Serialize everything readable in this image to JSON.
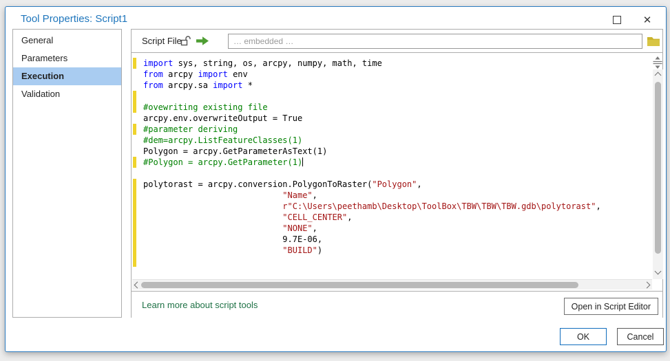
{
  "window": {
    "title": "Tool Properties: Script1",
    "close_icon": "✕"
  },
  "sidebar": {
    "items": [
      {
        "label": "General",
        "selected": false
      },
      {
        "label": "Parameters",
        "selected": false
      },
      {
        "label": "Execution",
        "selected": true
      },
      {
        "label": "Validation",
        "selected": false
      }
    ]
  },
  "script_file": {
    "label": "Script File",
    "placeholder": "… embedded …"
  },
  "editor": {
    "lines": [
      {
        "changed": true,
        "segments": [
          [
            "import",
            "kw"
          ],
          [
            " sys, string, os, arcpy, numpy, math, time",
            "pl"
          ]
        ]
      },
      {
        "changed": false,
        "segments": [
          [
            "from",
            "kw"
          ],
          [
            " arcpy ",
            "pl"
          ],
          [
            "import",
            "kw"
          ],
          [
            " env",
            "pl"
          ]
        ]
      },
      {
        "changed": false,
        "segments": [
          [
            "from",
            "kw"
          ],
          [
            " arcpy.sa ",
            "pl"
          ],
          [
            "import",
            "kw"
          ],
          [
            " *",
            "pl"
          ]
        ]
      },
      {
        "changed": true,
        "segments": []
      },
      {
        "changed": true,
        "segments": [
          [
            "#ovewriting existing file",
            "cm"
          ]
        ]
      },
      {
        "changed": false,
        "segments": [
          [
            "arcpy.env.overwriteOutput = True",
            "pl"
          ]
        ]
      },
      {
        "changed": true,
        "segments": [
          [
            "#parameter deriving",
            "cm"
          ]
        ]
      },
      {
        "changed": false,
        "segments": [
          [
            "#dem=arcpy.ListFeatureClasses(1)",
            "cm"
          ]
        ]
      },
      {
        "changed": false,
        "segments": [
          [
            "Polygon = arcpy.GetParameterAsText(1)",
            "pl"
          ]
        ]
      },
      {
        "changed": true,
        "cursor": true,
        "segments": [
          [
            "#Polygon = arcpy.GetParameter(1)",
            "cm"
          ]
        ]
      },
      {
        "changed": false,
        "segments": []
      },
      {
        "changed": true,
        "segments": [
          [
            "polytorast = arcpy.conversion.PolygonToRaster(",
            "pl"
          ],
          [
            "\"Polygon\"",
            "st"
          ],
          [
            ",",
            "pl"
          ]
        ]
      },
      {
        "changed": true,
        "segments": [
          [
            "                            ",
            "pl"
          ],
          [
            "\"Name\"",
            "st"
          ],
          [
            ",",
            "pl"
          ]
        ]
      },
      {
        "changed": true,
        "segments": [
          [
            "                            ",
            "pl"
          ],
          [
            "r\"C:\\Users\\peethamb\\Desktop\\ToolBox\\TBW\\TBW\\TBW.gdb\\polytorast\"",
            "st"
          ],
          [
            ",",
            "pl"
          ]
        ]
      },
      {
        "changed": true,
        "segments": [
          [
            "                            ",
            "pl"
          ],
          [
            "\"CELL_CENTER\"",
            "st"
          ],
          [
            ",",
            "pl"
          ]
        ]
      },
      {
        "changed": true,
        "segments": [
          [
            "                            ",
            "pl"
          ],
          [
            "\"NONE\"",
            "st"
          ],
          [
            ",",
            "pl"
          ]
        ]
      },
      {
        "changed": true,
        "segments": [
          [
            "                            9.7E-06,",
            "pl"
          ]
        ]
      },
      {
        "changed": true,
        "segments": [
          [
            "                            ",
            "pl"
          ],
          [
            "\"BUILD\"",
            "st"
          ],
          [
            ")",
            "pl"
          ]
        ]
      },
      {
        "changed": true,
        "segments": []
      },
      {
        "changed": false,
        "segments": []
      }
    ]
  },
  "footer": {
    "link_label": "Learn more about script tools",
    "open_button_label": "Open in Script Editor"
  },
  "actions": {
    "ok_label": "OK",
    "cancel_label": "Cancel"
  },
  "colors": {
    "accent_blue": "#1f76bc",
    "selection_blue": "#a9ccf1",
    "keyword_blue": "#0000ff",
    "comment_green": "#008000",
    "string_red": "#a31515",
    "changed_bar_yellow": "#efd32c",
    "link_green": "#1e7145",
    "arrow_green": "#4f9e33",
    "folder_gold": "#cbb52e"
  }
}
